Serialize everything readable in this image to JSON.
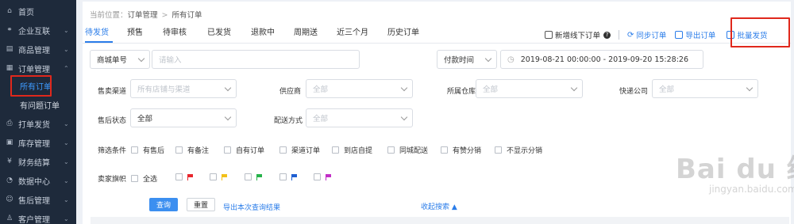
{
  "sidebar": {
    "items": [
      {
        "label": "首页",
        "icon": "home-icon",
        "glyph": "⌂",
        "expanded": null
      },
      {
        "label": "企业互联",
        "icon": "link-icon",
        "glyph": "⚭",
        "expanded": false
      },
      {
        "label": "商品管理",
        "icon": "product-icon",
        "glyph": "▤",
        "expanded": false
      },
      {
        "label": "订单管理",
        "icon": "order-icon",
        "glyph": "▦",
        "expanded": true
      },
      {
        "label": "打单发货",
        "icon": "print-icon",
        "glyph": "⎙",
        "expanded": false
      },
      {
        "label": "库存管理",
        "icon": "inventory-icon",
        "glyph": "▣",
        "expanded": false
      },
      {
        "label": "财务结算",
        "icon": "finance-icon",
        "glyph": "¥",
        "expanded": false
      },
      {
        "label": "数据中心",
        "icon": "data-icon",
        "glyph": "◔",
        "expanded": false
      },
      {
        "label": "售后管理",
        "icon": "after-sale-icon",
        "glyph": "☺",
        "expanded": false
      },
      {
        "label": "客户管理",
        "icon": "customer-icon",
        "glyph": "♙",
        "expanded": false
      }
    ],
    "sub_items": [
      {
        "label": "所有订单",
        "active": true
      },
      {
        "label": "有问题订单",
        "active": false
      }
    ]
  },
  "breadcrumb": {
    "prefix": "当前位置：",
    "section": "订单管理",
    "separator": ">",
    "current": "所有订单"
  },
  "tabs": [
    "待发货",
    "预售",
    "待审核",
    "已发货",
    "退款中",
    "周期送",
    "近三个月",
    "历史订单"
  ],
  "actions": {
    "new_offline": "新增线下订单",
    "help": "?",
    "sync": "同步订单",
    "export": "导出订单",
    "batch_ship": "批量发货"
  },
  "search": {
    "type_select": "商城单号",
    "input_placeholder": "请输入",
    "time_select": "付款时间",
    "date_range": "2019-08-21 00:00:00  -  2019-09-20 15:28:26"
  },
  "filters": {
    "channel_label": "售卖渠道",
    "channel_placeholder": "所有店铺与渠道",
    "supplier_label": "供应商",
    "supplier_value": "全部",
    "warehouse_label": "所属仓库",
    "warehouse_value": "全部",
    "express_label": "快递公司",
    "express_value": "全部",
    "after_sale_label": "售后状态",
    "after_sale_value": "全部",
    "delivery_label": "配送方式",
    "delivery_value": "全部"
  },
  "conditions": {
    "label": "筛选条件",
    "options": [
      "有售后",
      "有备注",
      "自有订单",
      "渠道订单",
      "到店自提",
      "同城配送",
      "有赞分销",
      "不显示分销"
    ]
  },
  "seller_flags": {
    "label": "卖家旗帜",
    "all": "全选",
    "colors": [
      "#e8262d",
      "#f2c018",
      "#27b24a",
      "#1f5fd1",
      "#c22fc7"
    ]
  },
  "buttons": {
    "query": "查询",
    "reset": "重置",
    "export_results": "导出本次查询结果",
    "collapse": "收起搜索 ▲"
  },
  "watermark": {
    "main": "Bai du 经验",
    "sub": "jingyan.baidu.com"
  }
}
